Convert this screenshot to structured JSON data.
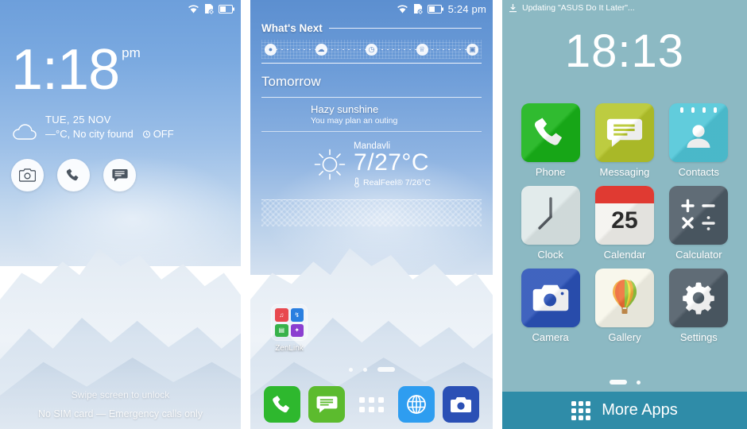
{
  "panel1": {
    "name": "lock-screen",
    "statusbar": {
      "icons": [
        "wifi-icon",
        "sim-missing-icon",
        "battery-icon"
      ]
    },
    "clock": {
      "time": "1:18",
      "ampm": "pm"
    },
    "weather": {
      "icon": "cloud-icon",
      "date": "TUE, 25 NOV",
      "condition": "—°C, No city found",
      "alarm_icon": "alarm-icon",
      "alarm_state": "OFF"
    },
    "shortcuts": [
      {
        "name": "camera-shortcut",
        "icon": "camera-icon"
      },
      {
        "name": "phone-shortcut",
        "icon": "phone-icon"
      },
      {
        "name": "messaging-shortcut",
        "icon": "message-icon"
      }
    ],
    "hint": "Swipe screen to unlock",
    "sim_status": "No SIM card — Emergency calls only"
  },
  "panel2": {
    "name": "home-screen-whats-next",
    "statusbar": {
      "icons": [
        "wifi-icon",
        "sim-missing-icon",
        "battery-icon"
      ],
      "time": "5:24 pm"
    },
    "widget": {
      "title": "What's Next",
      "timeline_icons": [
        "event-icon",
        "weather-icon",
        "clock-icon",
        "birthday-icon",
        "camera-icon"
      ],
      "day": "Tomorrow",
      "headline": "Hazy sunshine",
      "subline": "You may plan an outing",
      "city": "Mandavli",
      "temperature": "7/27°C",
      "realfeel": "RealFeel® 7/26°C",
      "sun_icon": "sun-icon",
      "thermometer_icon": "thermometer-icon"
    },
    "folder": {
      "label": "ZenLink",
      "tiles": [
        {
          "name": "party-link-icon",
          "color": "#e8494f"
        },
        {
          "name": "share-link-icon",
          "color": "#2a7fe0"
        },
        {
          "name": "remote-link-icon",
          "color": "#37b24a"
        },
        {
          "name": "photo-collage-icon",
          "color": "#8b3fd0"
        }
      ]
    },
    "page_indicator": {
      "pages": 3,
      "active": 3
    },
    "dock": [
      {
        "name": "dock-phone",
        "label": "Phone",
        "icon": "phone-icon",
        "color": "#2eb82e"
      },
      {
        "name": "dock-messaging",
        "label": "Messaging",
        "icon": "message-icon",
        "color": "#5cbb2e"
      },
      {
        "name": "dock-all-apps",
        "label": "All apps",
        "icon": "apps-grid-icon",
        "color": "transparent"
      },
      {
        "name": "dock-browser",
        "label": "Browser",
        "icon": "globe-icon",
        "color": "#2e9df0"
      },
      {
        "name": "dock-camera",
        "label": "Camera",
        "icon": "camera-icon",
        "color": "#2b50b5"
      }
    ]
  },
  "panel3": {
    "name": "app-drawer",
    "notification": {
      "icon": "download-icon",
      "text": "Updating \"ASUS Do It Later\"..."
    },
    "clock": "18:13",
    "apps": [
      {
        "label": "Phone",
        "icon": "phone-icon",
        "color": "#19b319"
      },
      {
        "label": "Messaging",
        "icon": "message-icon",
        "color": "#b6c62b"
      },
      {
        "label": "Contacts",
        "icon": "contact-icon",
        "color": "#4fc6d8"
      },
      {
        "label": "Clock",
        "icon": "clock-icon",
        "color": "#dfe9e9"
      },
      {
        "label": "Calendar",
        "icon": "calendar-icon",
        "color": "#f4f3ef",
        "day": "25"
      },
      {
        "label": "Calculator",
        "icon": "calculator-icon",
        "color": "#4e5b66"
      },
      {
        "label": "Camera",
        "icon": "camera-icon",
        "color": "#2b52b8"
      },
      {
        "label": "Gallery",
        "icon": "balloon-icon",
        "color": "#f7f6ea"
      },
      {
        "label": "Settings",
        "icon": "gear-icon",
        "color": "#4e5b66"
      }
    ],
    "page_indicator": {
      "pages": 2,
      "active": 1
    },
    "more_apps": {
      "label": "More Apps",
      "icon": "apps-grid-icon"
    }
  },
  "colors": {
    "drawer_bg": "#8cb9c3",
    "more_apps_bar": "#2f8ca8",
    "sky_top": "#6d9fdb",
    "snow": "#e8eff6"
  }
}
